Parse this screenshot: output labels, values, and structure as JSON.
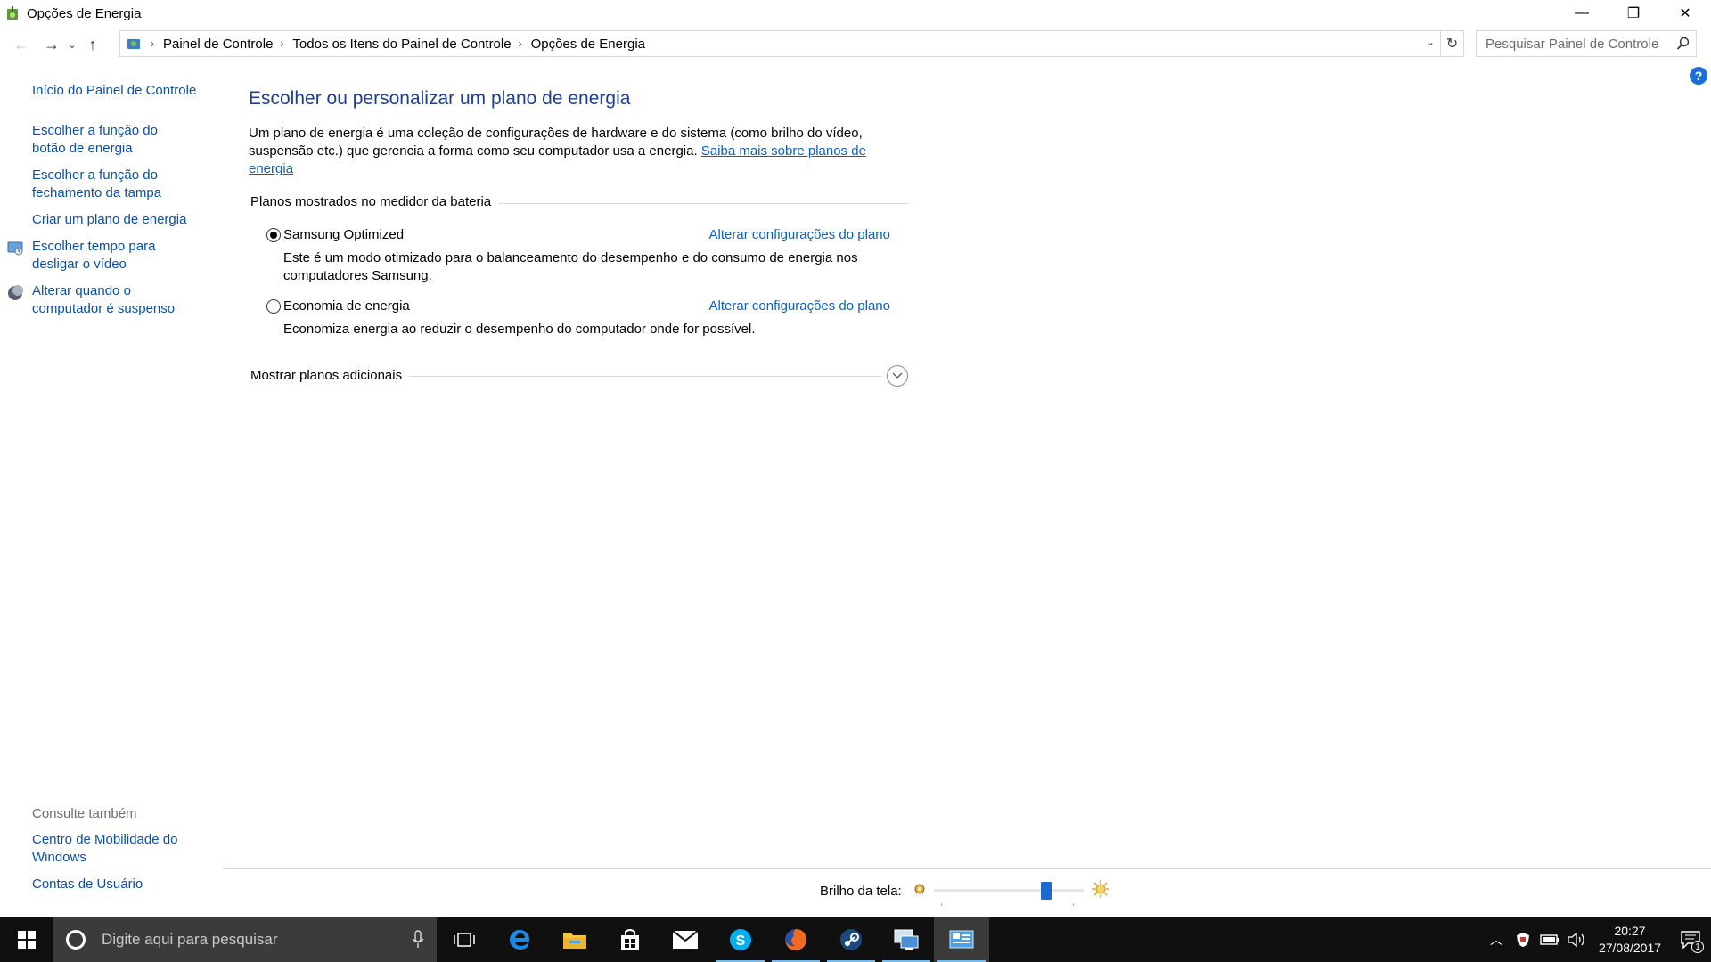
{
  "window": {
    "title": "Opções de Energia",
    "controls": {
      "minimize": "—",
      "restore": "❐",
      "close": "✕"
    }
  },
  "address": {
    "crumbs": [
      "Painel de Controle",
      "Todos os Itens do Painel de Controle",
      "Opções de Energia"
    ],
    "search_placeholder": "Pesquisar Painel de Controle"
  },
  "sidebar": {
    "home": "Início do Painel de Controle",
    "items": [
      {
        "label": "Escolher a função do botão de energia",
        "icon": "none"
      },
      {
        "label": "Escolher a função do fechamento da tampa",
        "icon": "none"
      },
      {
        "label": "Criar um plano de energia",
        "icon": "none"
      },
      {
        "label": "Escolher tempo para desligar o vídeo",
        "icon": "display-icon"
      },
      {
        "label": "Alterar quando o computador é suspenso",
        "icon": "moon-icon"
      }
    ],
    "see_also": {
      "heading": "Consulte também",
      "links": [
        "Centro de Mobilidade do Windows",
        "Contas de Usuário"
      ]
    }
  },
  "main": {
    "heading": "Escolher ou personalizar um plano de energia",
    "intro_text": "Um plano de energia é uma coleção de configurações de hardware e do sistema (como brilho do vídeo, suspensão etc.) que gerencia a forma como seu computador usa a energia. ",
    "intro_link": "Saiba mais sobre planos de energia",
    "group_label": "Planos mostrados no medidor da bateria",
    "plans": [
      {
        "name": "Samsung Optimized",
        "selected": true,
        "change_link": "Alterar configurações do plano",
        "description": "Este é um modo otimizado para o balanceamento do desempenho e do consumo de energia nos computadores Samsung."
      },
      {
        "name": "Economia de energia",
        "selected": false,
        "change_link": "Alterar configurações do plano",
        "description": "Economiza energia ao reduzir o desempenho do computador onde for possível."
      }
    ],
    "more_plans": "Mostrar planos adicionais",
    "help": "?"
  },
  "brightness": {
    "label": "Brilho da tela:",
    "level_fraction": 0.77
  },
  "taskbar": {
    "search_placeholder": "Digite aqui para pesquisar",
    "apps": [
      "task-view-icon",
      "edge-icon",
      "file-explorer-icon",
      "store-icon",
      "mail-icon",
      "skype-icon",
      "firefox-icon",
      "steam-icon",
      "remote-desktop-icon",
      "control-panel-icon"
    ],
    "clock_time": "20:27",
    "clock_date": "27/08/2017",
    "notification_count": "1"
  },
  "colors": {
    "link": "#0a4fa8",
    "heading": "#1e3e8f",
    "accent": "#1a6bd1",
    "taskbar": "#101010"
  }
}
